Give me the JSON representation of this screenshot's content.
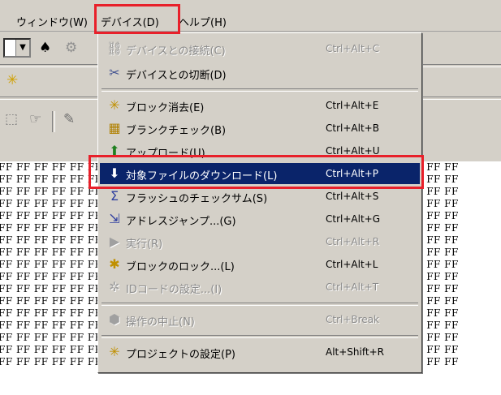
{
  "menubar": {
    "window": "ウィンドウ(W)",
    "device": "デバイス(D)",
    "help": "ヘルプ(H)"
  },
  "device_menu": {
    "items": [
      {
        "label": "デバイスとの接続(C)",
        "shortcut": "Ctrl+Alt+C",
        "icon": "connect-icon",
        "enabled": false
      },
      {
        "label": "デバイスとの切断(D)",
        "shortcut": "",
        "icon": "disconnect-icon",
        "enabled": true
      },
      {
        "label": "ブロック消去(E)",
        "shortcut": "Ctrl+Alt+E",
        "icon": "block-erase-icon",
        "enabled": true
      },
      {
        "label": "ブランクチェック(B)",
        "shortcut": "Ctrl+Alt+B",
        "icon": "blank-check-icon",
        "enabled": true
      },
      {
        "label": "アップロード(U)",
        "shortcut": "Ctrl+Alt+U",
        "icon": "upload-icon",
        "enabled": true
      },
      {
        "label": "対象ファイルのダウンロード(L)",
        "shortcut": "Ctrl+Alt+P",
        "icon": "download-icon",
        "enabled": true,
        "active": true
      },
      {
        "label": "フラッシュのチェックサム(S)",
        "shortcut": "Ctrl+Alt+S",
        "icon": "checksum-icon",
        "enabled": true
      },
      {
        "label": "アドレスジャンプ...(G)",
        "shortcut": "Ctrl+Alt+G",
        "icon": "address-jump-icon",
        "enabled": true
      },
      {
        "label": "実行(R)",
        "shortcut": "Ctrl+Alt+R",
        "icon": "run-icon",
        "enabled": false
      },
      {
        "label": "ブロックのロック...(L)",
        "shortcut": "Ctrl+Alt+L",
        "icon": "block-lock-icon",
        "enabled": true
      },
      {
        "label": "IDコードの設定...(I)",
        "shortcut": "Ctrl+Alt+T",
        "icon": "id-code-icon",
        "enabled": false
      },
      {
        "label": "操作の中止(N)",
        "shortcut": "Ctrl+Break",
        "icon": "stop-icon",
        "enabled": false
      },
      {
        "label": "プロジェクトの設定(P)",
        "shortcut": "Alt+Shift+R",
        "icon": "project-settings-icon",
        "enabled": true
      }
    ]
  },
  "dump": {
    "cell": "FF"
  },
  "colors": {
    "menu_bg": "#d4d0c8",
    "selection": "#0a246a",
    "callout": "#e8202a"
  }
}
